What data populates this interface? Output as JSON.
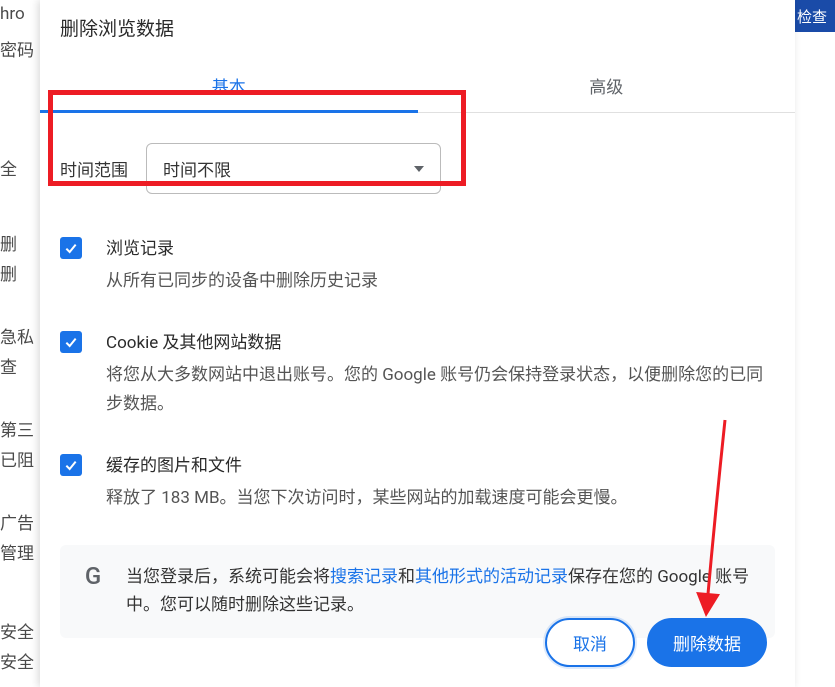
{
  "background": {
    "items": [
      "hro",
      "密码",
      "全",
      "删",
      "删",
      "急私",
      "查",
      "第三",
      "已阻",
      "广告",
      "管理",
      "安全",
      "安全"
    ],
    "topRight": "检查"
  },
  "dialog": {
    "title": "删除浏览数据",
    "tabs": {
      "basic": "基本",
      "advanced": "高级"
    },
    "timeRange": {
      "label": "时间范围",
      "value": "时间不限"
    },
    "items": {
      "history": {
        "title": "浏览记录",
        "desc": "从所有已同步的设备中删除历史记录"
      },
      "cookies": {
        "title": "Cookie 及其他网站数据",
        "desc": "将您从大多数网站中退出账号。您的 Google 账号仍会保持登录状态，以便删除您的已同步数据。"
      },
      "cache": {
        "title": "缓存的图片和文件",
        "desc": "释放了 183 MB。当您下次访问时，某些网站的加载速度可能会更慢。"
      }
    },
    "info": {
      "text1": "当您登录后，系统可能会将",
      "link1": "搜索记录",
      "text2": "和",
      "link2": "其他形式的活动记录",
      "text3": "保存在您的 Google 账号中。您可以随时删除这些记录。"
    },
    "buttons": {
      "cancel": "取消",
      "confirm": "删除数据"
    }
  }
}
